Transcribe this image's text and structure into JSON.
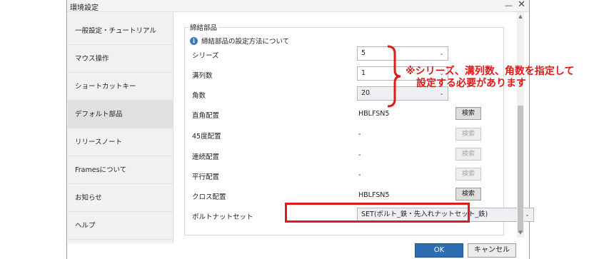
{
  "window": {
    "title": "環境設定"
  },
  "sidebar": {
    "items": [
      {
        "label": "一般設定・チュートリアル"
      },
      {
        "label": "マウス操作"
      },
      {
        "label": "ショートカットキー"
      },
      {
        "label": "デフォルト部品"
      },
      {
        "label": "リリースノート"
      },
      {
        "label": "Framesについて"
      },
      {
        "label": "お知らせ"
      },
      {
        "label": "ヘルプ"
      }
    ],
    "selected": "デフォルト部品"
  },
  "panel": {
    "group_title": "締結部品",
    "info_text": "締結部品の設定方法について",
    "rows": {
      "series": {
        "label": "シリーズ",
        "value": "5"
      },
      "rows_count": {
        "label": "溝列数",
        "value": "1"
      },
      "angle": {
        "label": "角数",
        "value": "20"
      },
      "right_angle": {
        "label": "直角配置",
        "value": "HBLFSN5",
        "button": "検索"
      },
      "deg45": {
        "label": "45度配置",
        "value": "-",
        "button": "検索"
      },
      "continuous": {
        "label": "連続配置",
        "value": "-",
        "button": "検索"
      },
      "parallel": {
        "label": "平行配置",
        "value": "-",
        "button": "検索"
      },
      "cross": {
        "label": "クロス配置",
        "value": "HBLFSN5",
        "button": "検索"
      },
      "bolt_nut": {
        "label": "ボルトナットセット",
        "value": "SET(ボルト_鉄・先入れナットセット_鉄)"
      }
    }
  },
  "footer": {
    "ok": "OK",
    "cancel": "キャンセル"
  },
  "annotation": {
    "line1": "※シリーズ、溝列数、角数を指定して",
    "line2": "設定する必要があります",
    "color": "#e01919"
  }
}
